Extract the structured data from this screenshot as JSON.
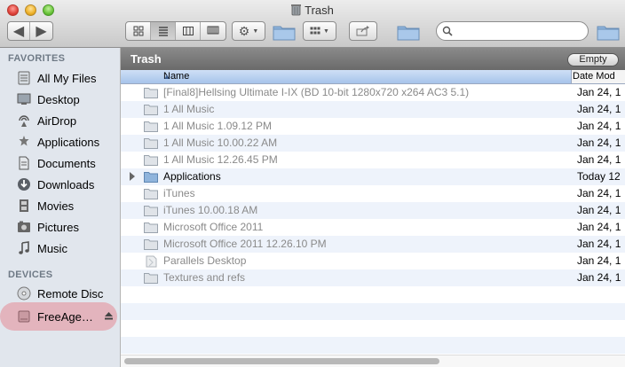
{
  "window": {
    "title": "Trash"
  },
  "toolbar": {
    "back_icon": "chevron-left-icon",
    "forward_icon": "chevron-right-icon",
    "view_icons": [
      "icon-view-icon",
      "list-view-icon",
      "column-view-icon",
      "coverflow-view-icon"
    ],
    "active_view": "list-view-icon",
    "action_icon": "gear-icon",
    "arrange_icon": "grid-arrange-icon",
    "share_icon": "share-icon",
    "search": {
      "value": "",
      "placeholder": ""
    }
  },
  "sidebar": {
    "favorites_header": "FAVORITES",
    "favorites": [
      {
        "label": "All My Files",
        "icon": "all-files-icon"
      },
      {
        "label": "Desktop",
        "icon": "desktop-icon"
      },
      {
        "label": "AirDrop",
        "icon": "airdrop-icon"
      },
      {
        "label": "Applications",
        "icon": "applications-icon"
      },
      {
        "label": "Documents",
        "icon": "documents-icon"
      },
      {
        "label": "Downloads",
        "icon": "downloads-icon"
      },
      {
        "label": "Movies",
        "icon": "movies-icon"
      },
      {
        "label": "Pictures",
        "icon": "pictures-icon"
      },
      {
        "label": "Music",
        "icon": "music-icon"
      }
    ],
    "devices_header": "DEVICES",
    "devices": [
      {
        "label": "Remote Disc",
        "icon": "remote-disc-icon"
      },
      {
        "label": "FreeAge…",
        "icon": "external-drive-icon"
      }
    ]
  },
  "main": {
    "path_title": "Trash",
    "empty_button": "Empty",
    "columns": {
      "name": "Name",
      "date": "Date Mod"
    },
    "rows": [
      {
        "name": "[Final8]Hellsing Ultimate I-IX (BD 10-bit 1280x720 x264 AC3 5.1)",
        "date": "Jan 24, 1",
        "icon": "folder-icon"
      },
      {
        "name": "1 All Music",
        "date": "Jan 24, 1",
        "icon": "folder-icon"
      },
      {
        "name": "1 All Music 1.09.12 PM",
        "date": "Jan 24, 1",
        "icon": "folder-icon"
      },
      {
        "name": "1 All Music 10.00.22 AM",
        "date": "Jan 24, 1",
        "icon": "folder-icon"
      },
      {
        "name": "1 All Music 12.26.45 PM",
        "date": "Jan 24, 1",
        "icon": "folder-icon"
      },
      {
        "name": "Applications",
        "date": "Today 12",
        "icon": "folder-icon"
      },
      {
        "name": "iTunes",
        "date": "Jan 24, 1",
        "icon": "folder-icon"
      },
      {
        "name": "iTunes 10.00.18 AM",
        "date": "Jan 24, 1",
        "icon": "folder-icon"
      },
      {
        "name": "Microsoft Office 2011",
        "date": "Jan 24, 1",
        "icon": "folder-icon"
      },
      {
        "name": "Microsoft Office 2011 12.26.10 PM",
        "date": "Jan 24, 1",
        "icon": "folder-icon"
      },
      {
        "name": "Parallels Desktop",
        "date": "Jan 24, 1",
        "icon": "app-icon"
      },
      {
        "name": "Textures and refs",
        "date": "Jan 24, 1",
        "icon": "folder-icon"
      }
    ]
  },
  "colors": {
    "selection_header": "#a6c3ea",
    "row_alt": "#eef3fb",
    "sidebar_bg": "#e1e6ed",
    "device_highlight": "#e6788a"
  }
}
